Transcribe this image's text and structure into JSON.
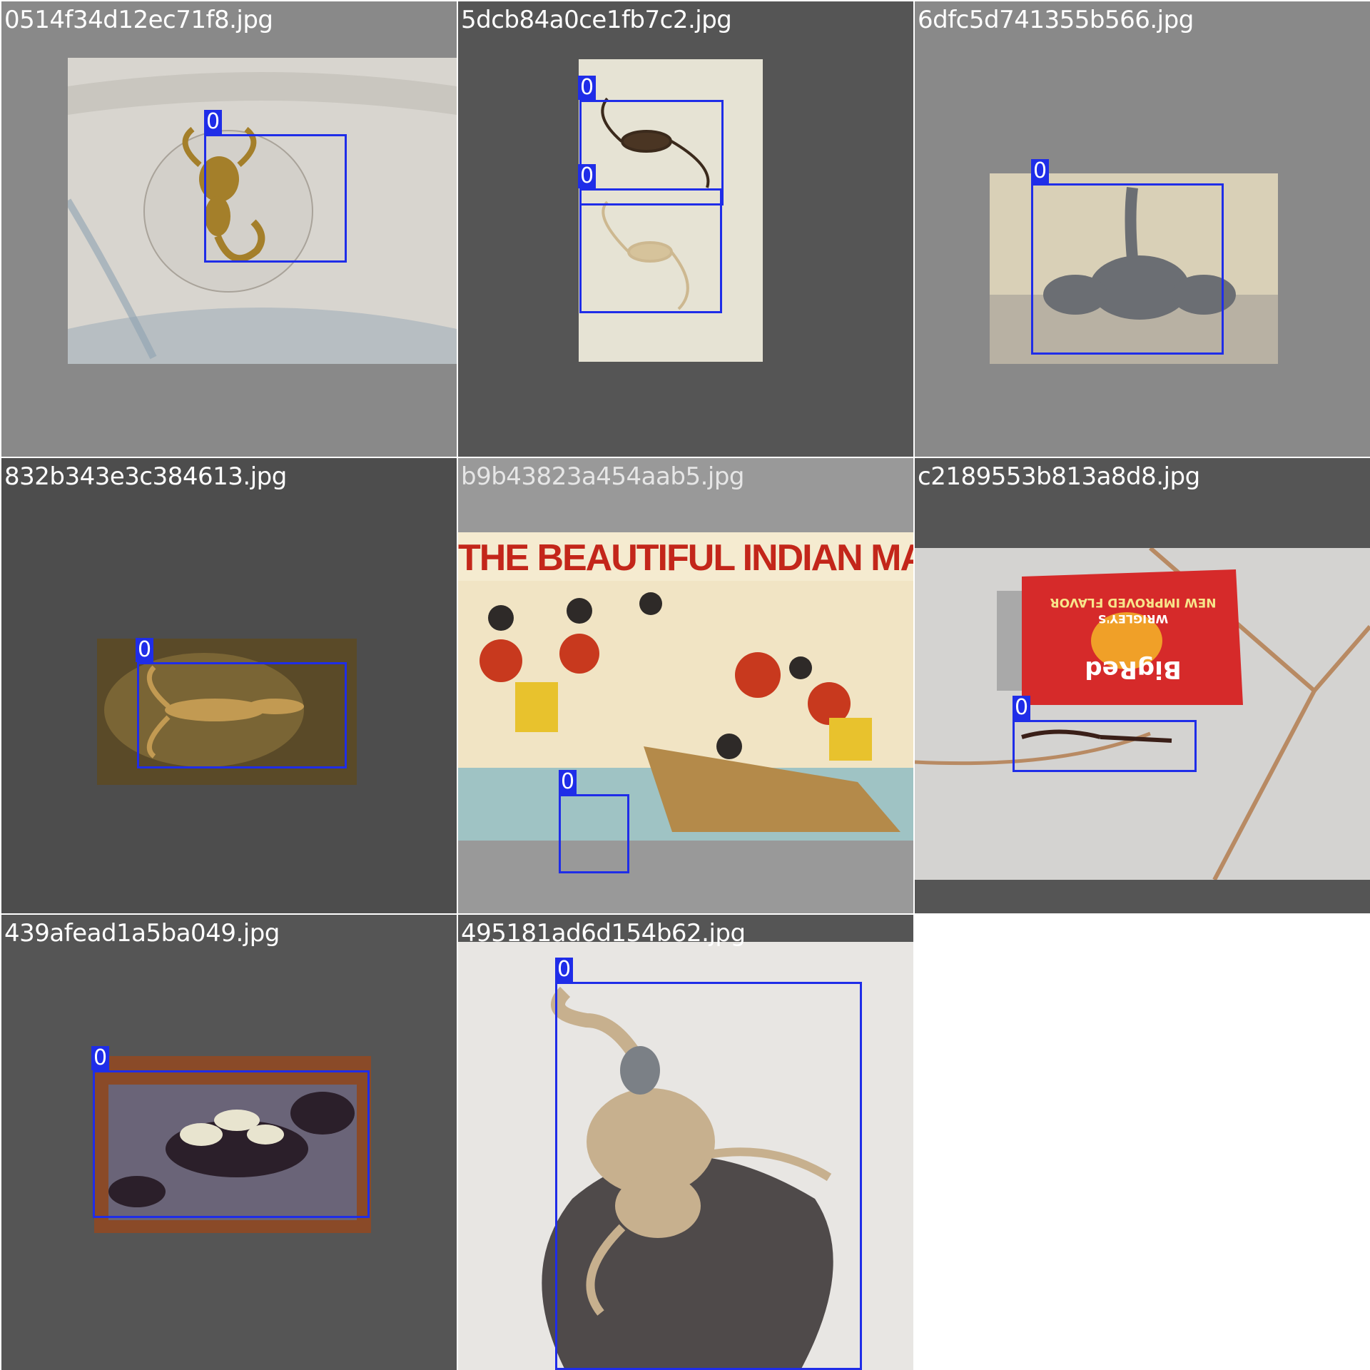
{
  "grid": {
    "tiles": [
      {
        "filename": "0514f34d12ec71f8.jpg",
        "label": "0"
      },
      {
        "filename": "5dcb84a0ce1fb7c2.jpg",
        "labels": [
          "0",
          "0"
        ]
      },
      {
        "filename": "6dfc5d741355b566.jpg",
        "label": "0"
      },
      {
        "filename": "832b343e3c384613.jpg",
        "label": "0"
      },
      {
        "filename": "b9b43823a454aab5.jpg",
        "label": "0",
        "poster_title": "THE BEAUTIFUL INDIAN MAIDENS"
      },
      {
        "filename": "c2189553b813a8d8.jpg",
        "label": "0",
        "pack_brand": "BigRed",
        "pack_maker": "WRIGLEY'S",
        "pack_flag": "NEW IMPROVED FLAVOR"
      },
      {
        "filename": "439afead1a5ba049.jpg",
        "label": "0"
      },
      {
        "filename": "495181ad6d154b62.jpg",
        "label": "0"
      }
    ]
  },
  "colors": {
    "bbox": "#1f2de8",
    "tile_bg_light": "#8a8a8a",
    "tile_bg_dark": "#555555"
  }
}
